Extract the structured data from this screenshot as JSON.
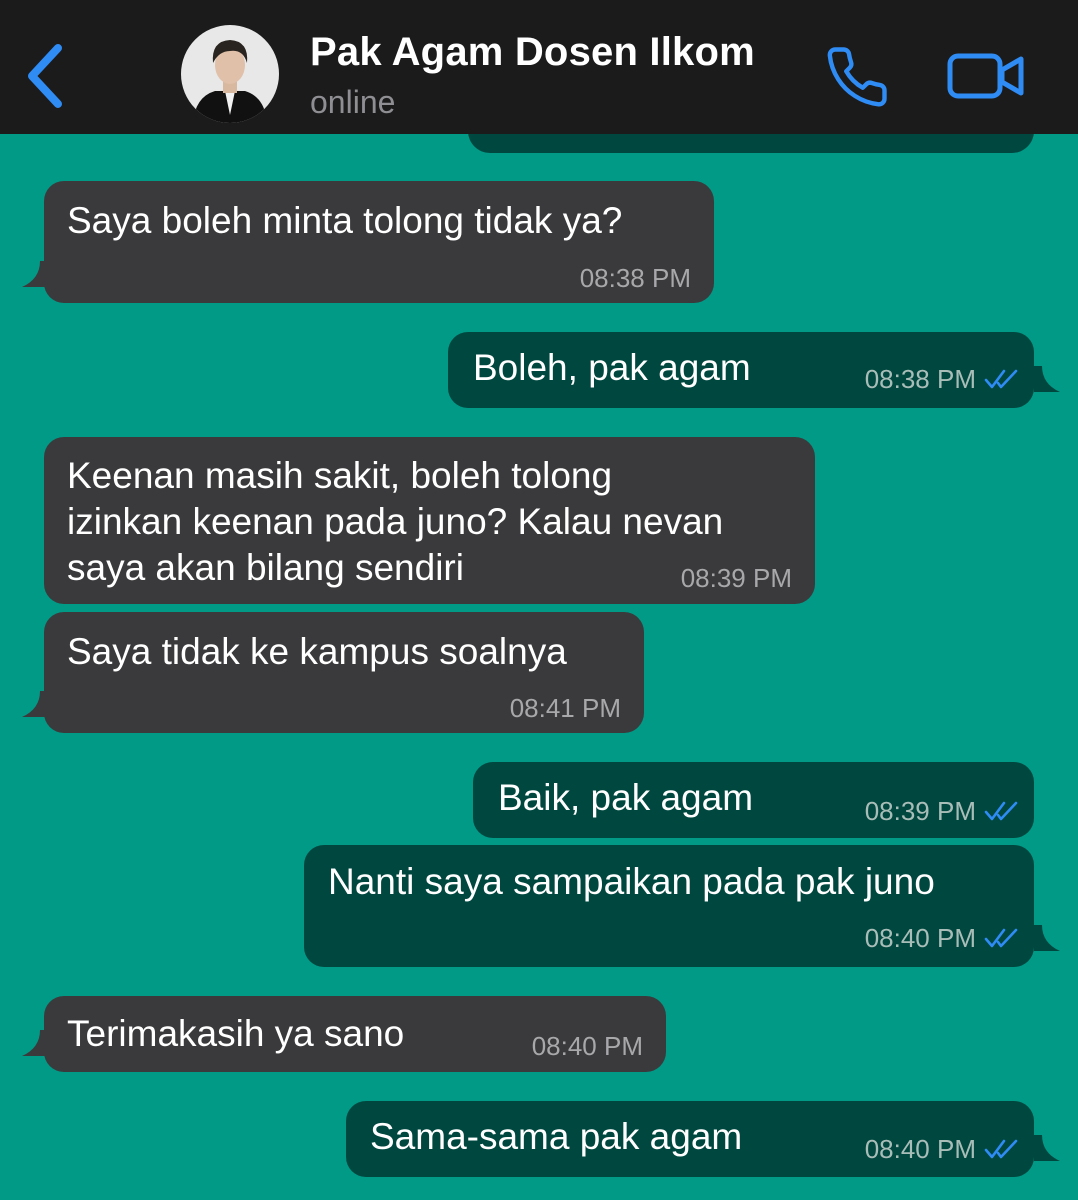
{
  "header": {
    "contact_name": "Pak Agam Dosen Ilkom",
    "status": "online"
  },
  "colors": {
    "background": "#009a86",
    "header": "#1b1b1b",
    "incoming_bubble": "#3a3a3c",
    "outgoing_bubble": "#00473f",
    "accent": "#2f8cf5"
  },
  "icons": {
    "back": "chevron-left-icon",
    "call": "phone-icon",
    "video": "video-camera-icon",
    "read_receipt": "double-check-icon"
  },
  "messages": [
    {
      "direction": "in",
      "lines": [
        "Saya boleh minta tolong tidak ya?"
      ],
      "time": "08:38 PM"
    },
    {
      "direction": "out",
      "lines": [
        "Boleh, pak agam"
      ],
      "time": "08:38 PM"
    },
    {
      "direction": "in",
      "lines": [
        "Keenan masih sakit, boleh tolong",
        "izinkan keenan pada juno? Kalau nevan",
        "saya akan bilang sendiri"
      ],
      "time": "08:39 PM"
    },
    {
      "direction": "in",
      "lines": [
        "Saya tidak ke kampus soalnya"
      ],
      "time": "08:41 PM"
    },
    {
      "direction": "out",
      "lines": [
        "Baik, pak agam"
      ],
      "time": "08:39 PM"
    },
    {
      "direction": "out",
      "lines": [
        "Nanti saya sampaikan pada pak juno"
      ],
      "time": "08:40 PM"
    },
    {
      "direction": "in",
      "lines": [
        "Terimakasih ya sano"
      ],
      "time": "08:40 PM"
    },
    {
      "direction": "out",
      "lines": [
        "Sama-sama pak agam"
      ],
      "time": "08:40 PM"
    }
  ]
}
